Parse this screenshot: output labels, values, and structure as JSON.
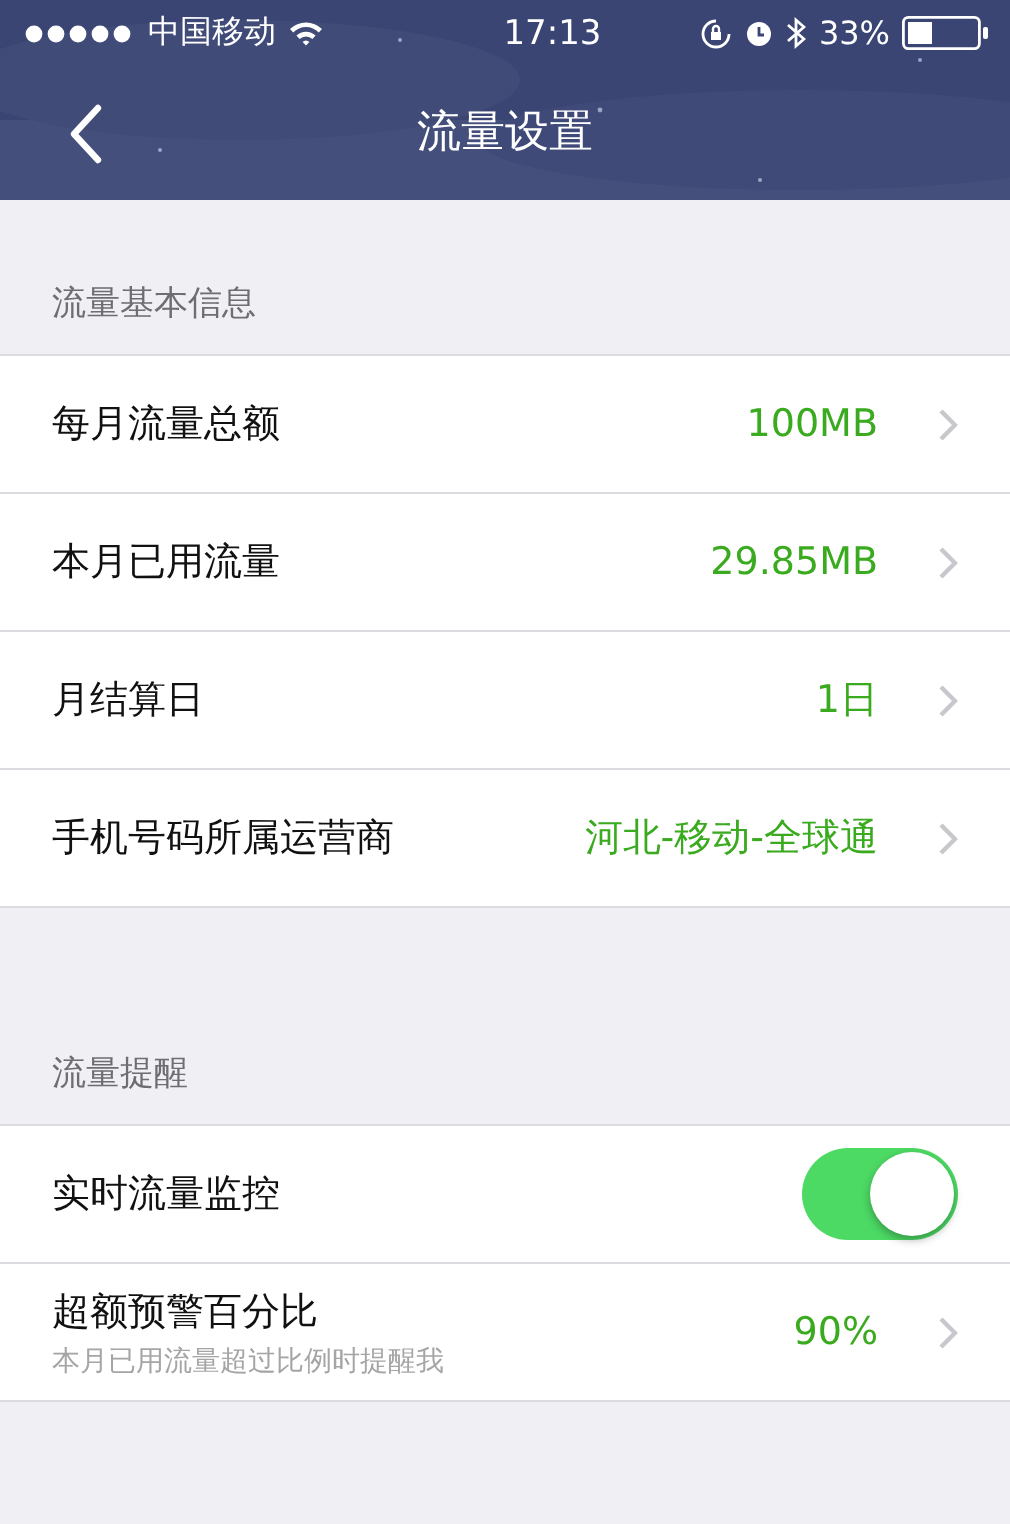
{
  "status_bar": {
    "carrier": "中国移动",
    "time": "17:13",
    "battery": "33%"
  },
  "nav": {
    "title": "流量设置"
  },
  "sections": [
    {
      "header": "流量基本信息",
      "rows": [
        {
          "kind": "value",
          "label": "每月流量总额",
          "value": "100MB"
        },
        {
          "kind": "value",
          "label": "本月已用流量",
          "value": "29.85MB"
        },
        {
          "kind": "value",
          "label": "月结算日",
          "value": "1日"
        },
        {
          "kind": "value",
          "label": "手机号码所属运营商",
          "value": "河北-移动-全球通"
        }
      ]
    },
    {
      "header": "流量提醒",
      "rows": [
        {
          "kind": "toggle",
          "label": "实时流量监控",
          "on": true
        },
        {
          "kind": "value",
          "label": "超额预警百分比",
          "subtitle": "本月已用流量超过比例时提醒我",
          "value": "90%"
        }
      ]
    }
  ]
}
